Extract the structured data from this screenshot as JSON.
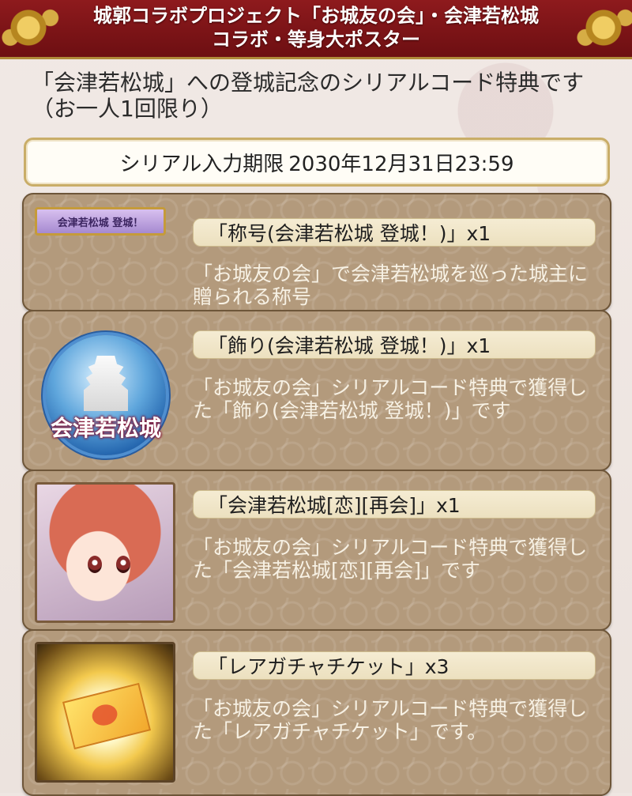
{
  "header": {
    "line1": "城郭コラボプロジェクト「お城友の会」・会津若松城",
    "line2": "コラボ・等身大ポスター"
  },
  "intro": "「会津若松城」への登城記念のシリアルコード特典です（お一人1回限り）",
  "deadline": {
    "label": "シリアル入力期限",
    "date": "2030年12月31日23:59"
  },
  "rewards": [
    {
      "title": "「称号(会津若松城 登城！)」x1",
      "description": "「お城友の会」で会津若松城を巡った城主に贈られる称号",
      "image_text": "会津若松城 登城！",
      "icon": "title-plate-icon"
    },
    {
      "title": "「飾り(会津若松城 登城！)」x1",
      "description": "「お城友の会」シリアルコード特典で獲得した「飾り(会津若松城 登城！)」です",
      "image_text": "会津若松城",
      "icon": "castle-badge-icon"
    },
    {
      "title": "「会津若松城[恋][再会]」x1",
      "description": "「お城友の会」シリアルコード特典で獲得した「会津若松城[恋][再会]」です",
      "icon": "character-portrait-icon"
    },
    {
      "title": "「レアガチャチケット」x3",
      "description": "「お城友の会」シリアルコード特典で獲得した「レアガチャチケット」です。",
      "icon": "gacha-ticket-icon"
    }
  ],
  "colors": {
    "header_red": "#8e1a1d",
    "panel_brown": "#b39a7c",
    "title_bar": "#f5ecd3",
    "gold_border": "#c9ad68"
  }
}
